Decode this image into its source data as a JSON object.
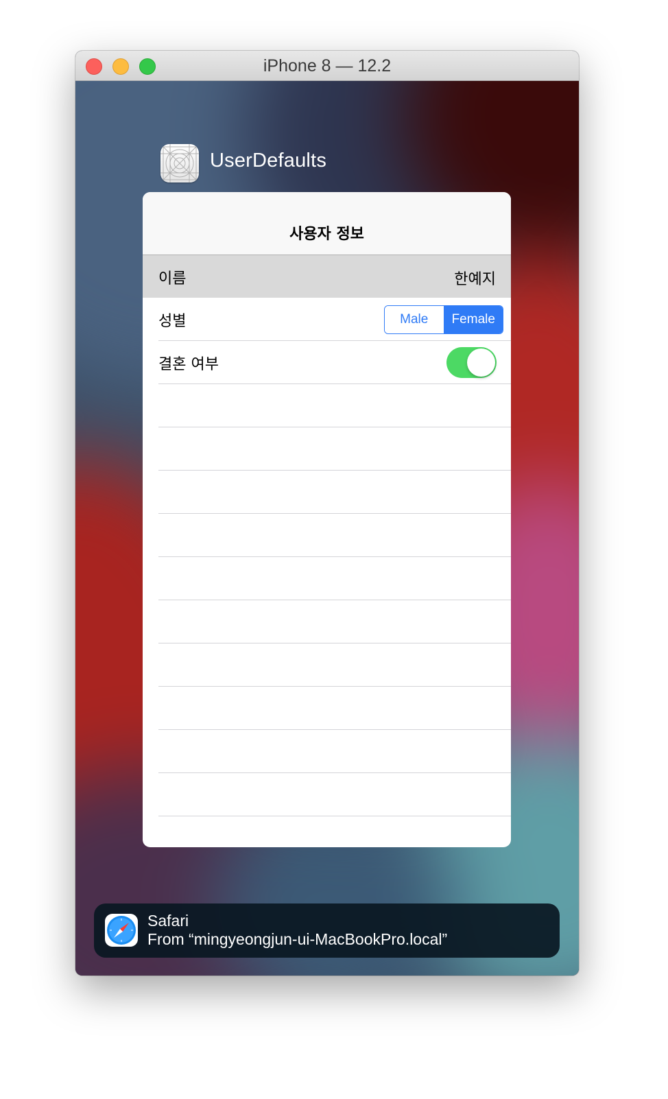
{
  "window": {
    "title": "iPhone 8 — 12.2"
  },
  "notification": {
    "app_name": "UserDefaults",
    "app_icon": "app-placeholder-grid-icon"
  },
  "nav": {
    "title": "사용자 정보"
  },
  "rows": [
    {
      "label": "이름",
      "value": "한예지",
      "selected": true
    },
    {
      "label": "성별",
      "control": "segmented",
      "options": [
        "Male",
        "Female"
      ],
      "selected_option": "Female"
    },
    {
      "label": "결혼 여부",
      "control": "switch",
      "on": true
    }
  ],
  "empty_row_count": 10,
  "banner": {
    "icon": "safari-compass-icon",
    "title": "Safari",
    "body": "From “mingyeongjun-ui-MacBookPro.local”"
  },
  "colors": {
    "tint": "#2f7bf6",
    "switch_on": "#4cd964",
    "selection": "#d9d9d9"
  }
}
